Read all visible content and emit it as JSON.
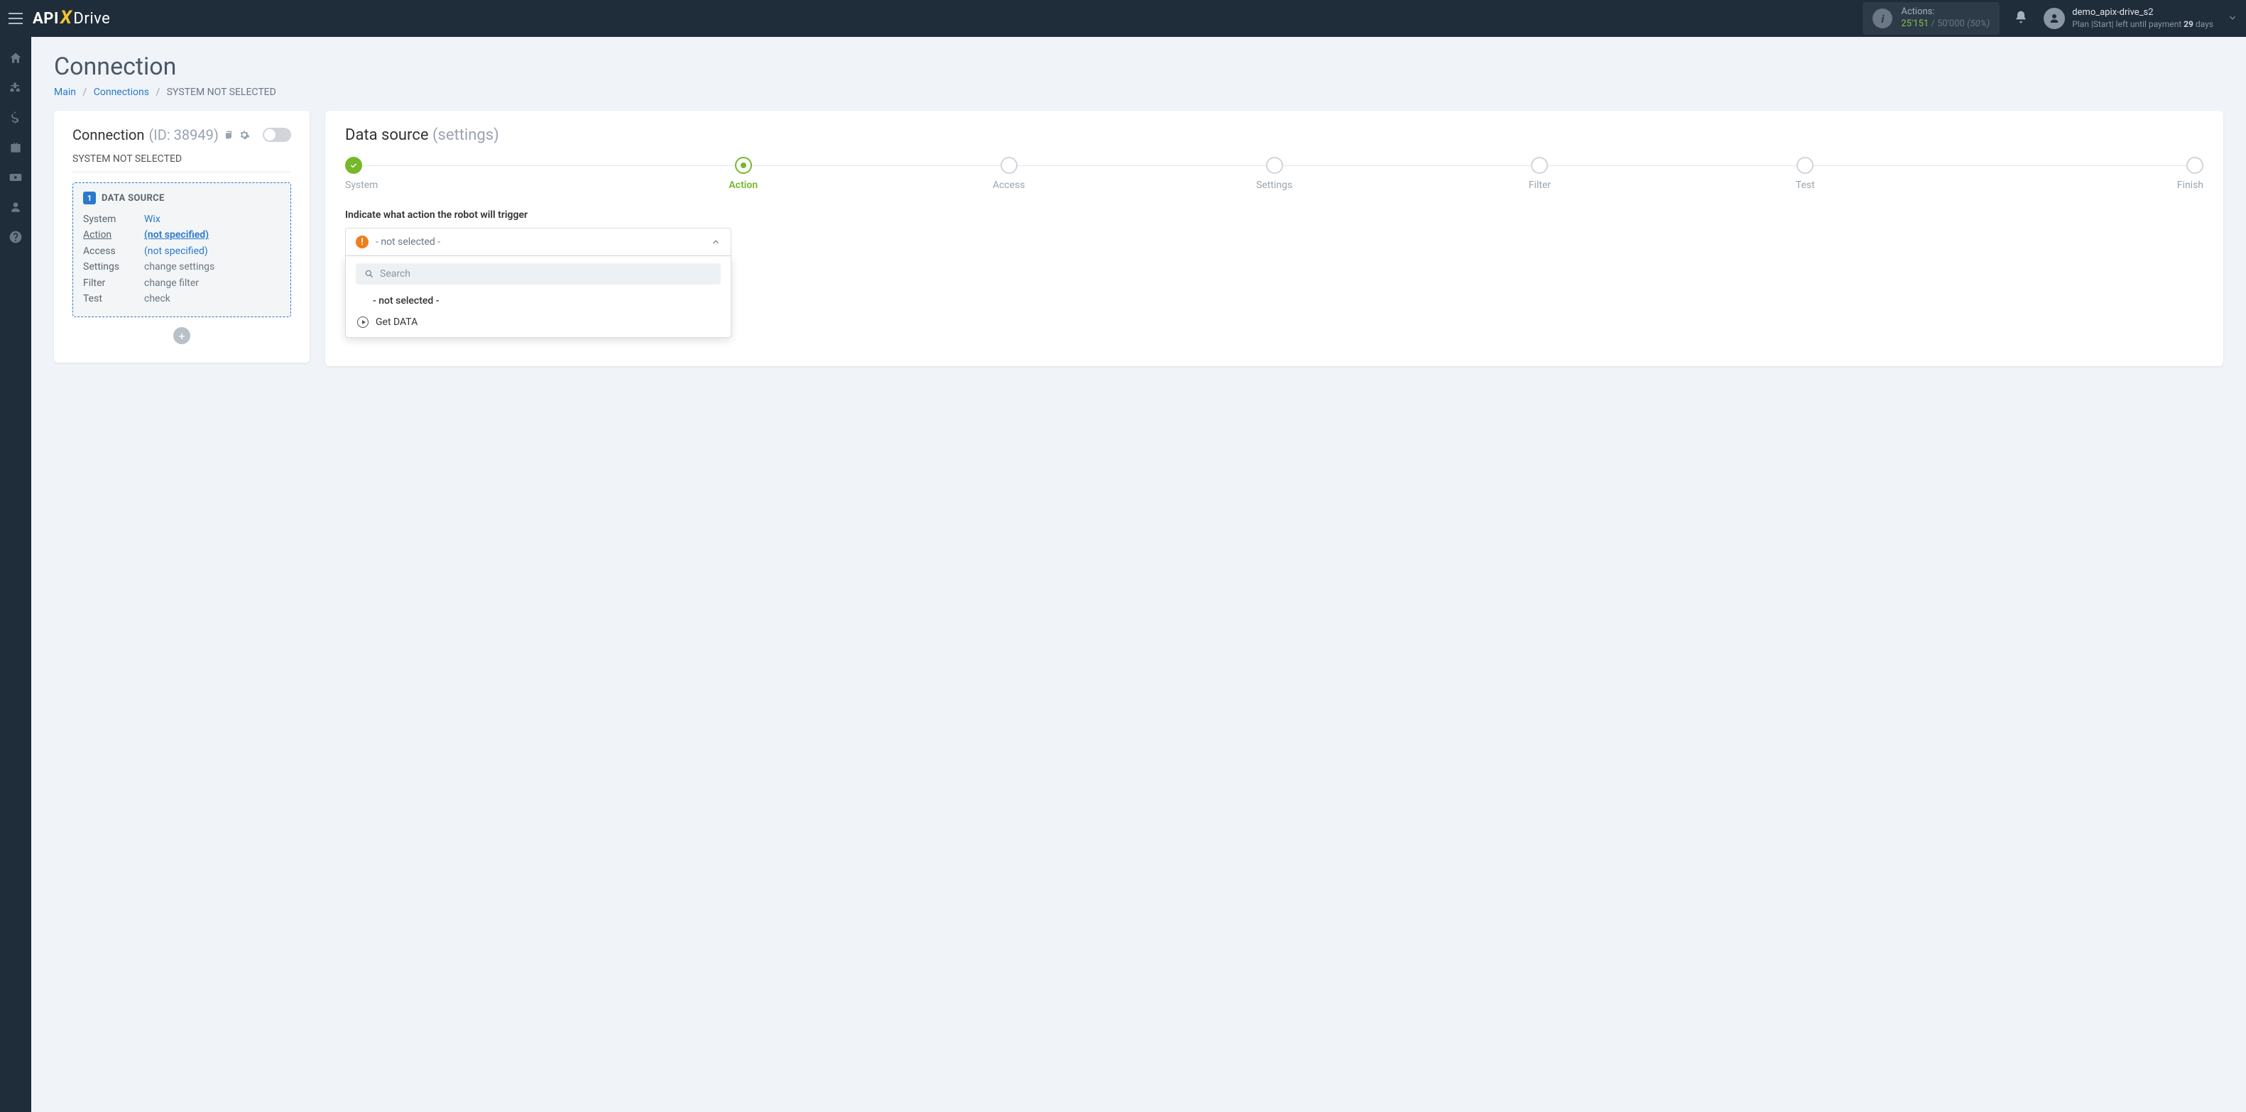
{
  "topbar": {
    "logo": {
      "part1": "API",
      "part2": "X",
      "part3": "Drive"
    },
    "actions": {
      "label": "Actions:",
      "used": "25'151",
      "total": "50'000",
      "pct": "(50%)"
    },
    "user": {
      "name": "demo_apix-drive_s2",
      "plan_prefix": "Plan |",
      "plan_name": "Start",
      "plan_mid": "| left until payment ",
      "plan_days": "29",
      "plan_suffix": " days"
    }
  },
  "page": {
    "title": "Connection",
    "breadcrumb": {
      "main": "Main",
      "connections": "Connections",
      "current": "SYSTEM NOT SELECTED"
    }
  },
  "leftCard": {
    "title": "Connection ",
    "id": "(ID: 38949)",
    "subtitle": "SYSTEM NOT SELECTED",
    "dsLabel": "DATA SOURCE",
    "rows": [
      {
        "k": "System",
        "v": "Wix",
        "cls": "link"
      },
      {
        "k": "Action",
        "v": "(not specified)",
        "cls": "link u",
        "kActive": true
      },
      {
        "k": "Access",
        "v": "(not specified)",
        "cls": "link"
      },
      {
        "k": "Settings",
        "v": "change settings",
        "cls": ""
      },
      {
        "k": "Filter",
        "v": "change filter",
        "cls": ""
      },
      {
        "k": "Test",
        "v": "check",
        "cls": ""
      }
    ]
  },
  "rightCard": {
    "title1": "Data source ",
    "title2": "(settings)",
    "steps": [
      "System",
      "Action",
      "Access",
      "Settings",
      "Filter",
      "Test",
      "Finish"
    ],
    "currentStep": 1,
    "prompt": "Indicate what action the robot will trigger",
    "select": {
      "placeholder": "- not selected -"
    },
    "search": {
      "placeholder": "Search"
    },
    "options": [
      {
        "label": "- not selected -",
        "muted": true
      },
      {
        "label": "Get DATA",
        "icon": true
      }
    ]
  }
}
